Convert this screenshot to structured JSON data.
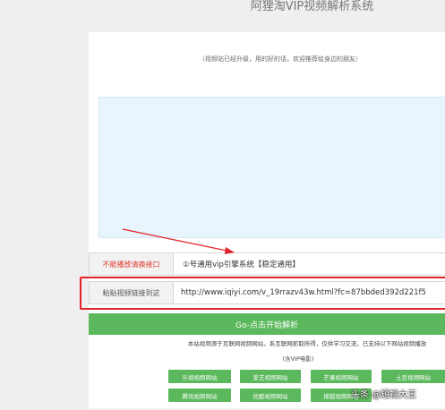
{
  "header": {
    "title": "阿狸淘VIP视频解析系统"
  },
  "notice": "（视频站已经升级，用的好的话，欢迎推荐给身边的朋友）",
  "api_row": {
    "label": "不能播放请换接口",
    "value": "①号通用vip引擎系统【稳定通用】"
  },
  "url_row": {
    "label": "粘贴视频链接到这",
    "value": "http://www.iqiyi.com/v_19rrazv43w.html?fc=87bbded392d221f5"
  },
  "go_button": "Go-点击开始解析",
  "disclaimer": "本站视频源于互联网视频网站，系互联网抓取所得，仅供学习交流，已支持以下网站视频播放",
  "disclaimer2": "(含VIP电影)",
  "sites": [
    "乐视视频网站",
    "爱艺视频网站",
    "芒果视频网站",
    "土豆视频网站",
    "腾讯视频网站",
    "优酷视频网站",
    "搜狐视频网站"
  ],
  "watermark": "头条 @短视大王",
  "colors": {
    "accent_green": "#5cb85c",
    "highlight_red": "#e2222a",
    "label_red": "#e03a2d"
  }
}
